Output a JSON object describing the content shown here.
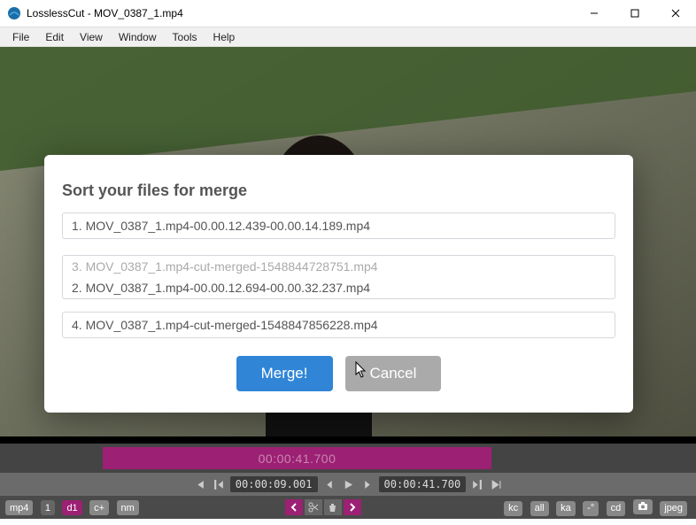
{
  "window": {
    "title": "LosslessCut - MOV_0387_1.mp4"
  },
  "menu": {
    "items": [
      "File",
      "Edit",
      "View",
      "Window",
      "Tools",
      "Help"
    ]
  },
  "modal": {
    "heading": "Sort your files for merge",
    "files": [
      "1. MOV_0387_1.mp4-00.00.12.439-00.00.14.189.mp4",
      "3. MOV_0387_1.mp4-cut-merged-1548844728751.mp4",
      "2. MOV_0387_1.mp4-00.00.12.694-00.00.32.237.mp4",
      "4. MOV_0387_1.mp4-cut-merged-1548847856228.mp4"
    ],
    "merge_label": "Merge!",
    "cancel_label": "Cancel"
  },
  "timeline": {
    "segment_label": "00:00:41.700"
  },
  "controls": {
    "start_tc": "00:00:09.001",
    "end_tc": "00:00:41.700"
  },
  "bottom": {
    "left": [
      "mp4",
      "1",
      "d1",
      "c+",
      "nm"
    ],
    "right": [
      "kc",
      "all",
      "ka",
      "-°",
      "cd",
      "",
      "jpeg"
    ]
  }
}
